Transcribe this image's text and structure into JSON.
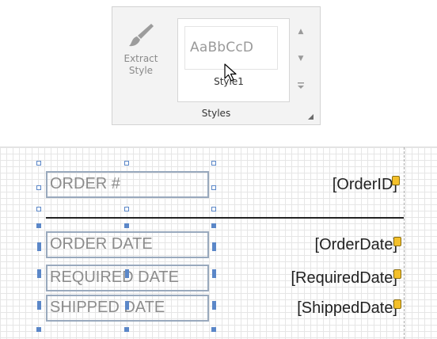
{
  "ribbon": {
    "extract_style": {
      "label": "Extract\nStyle",
      "icon": "brush-icon",
      "enabled": false
    },
    "style_gallery": {
      "preview_text": "AaBbCcD",
      "item_label": "Style1",
      "scroll_up_icon": "chevron-up-icon",
      "scroll_down_icon": "chevron-down-icon",
      "expand_icon": "gallery-more-icon"
    },
    "group_label": "Styles",
    "dialog_launcher_icon": "dialog-launcher-icon"
  },
  "report": {
    "rows": [
      {
        "label": "ORDER #",
        "field": "[OrderID]"
      },
      {
        "label": "ORDER DATE",
        "field": "[OrderDate]"
      },
      {
        "label": "REQUIRED DATE",
        "field": "[RequiredDate]"
      },
      {
        "label": "SHIPPED DATE",
        "field": "[ShippedDate]"
      }
    ],
    "field_tag_color": "#f4c02a",
    "selection_color": "#5b87c8"
  }
}
